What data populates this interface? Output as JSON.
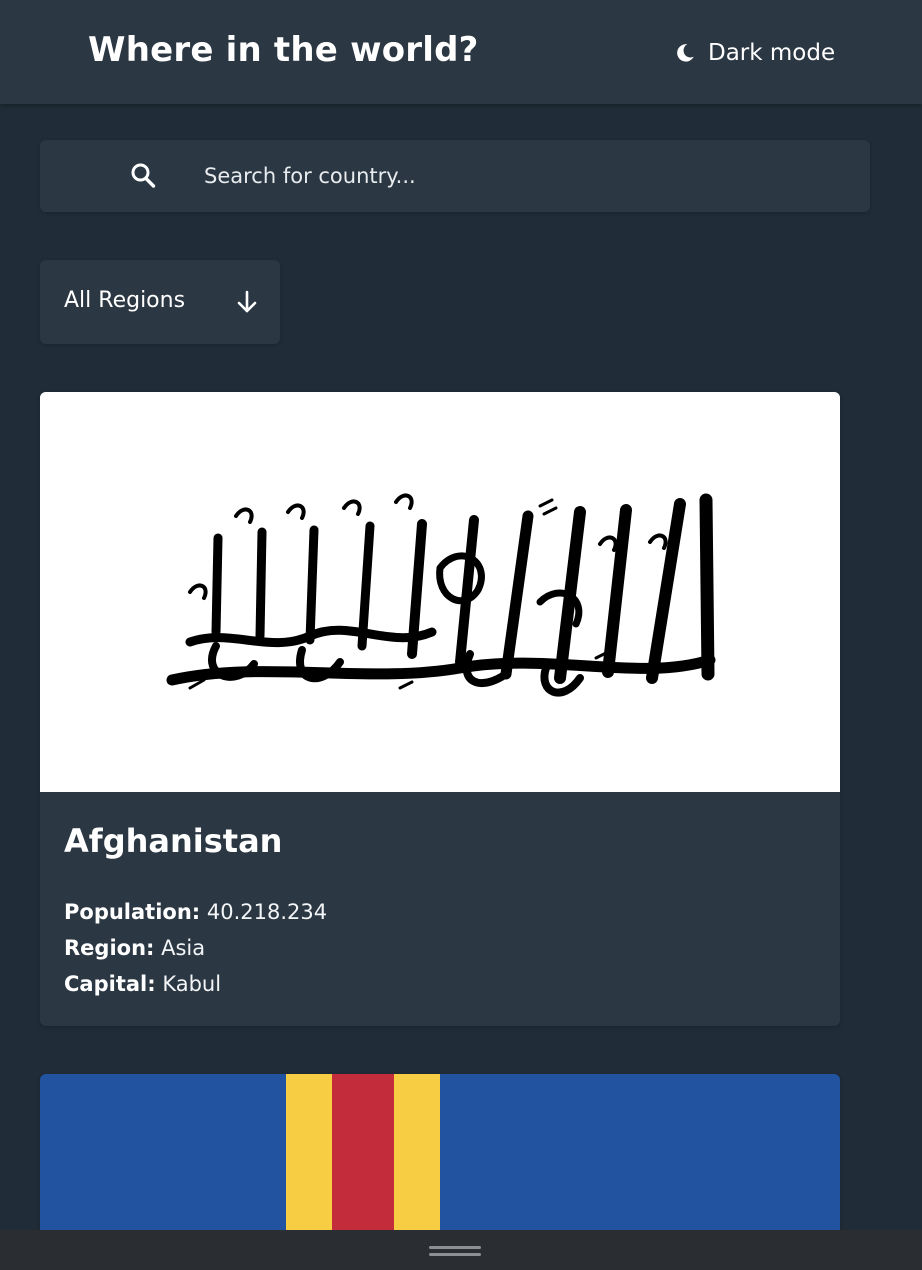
{
  "header": {
    "title": "Where in the world?",
    "mode_label": "Dark mode"
  },
  "search": {
    "placeholder": "Search for country...",
    "value": ""
  },
  "filter": {
    "selected": "All Regions"
  },
  "countries": [
    {
      "name": "Afghanistan",
      "population_label": "Population:",
      "population": "40.218.234",
      "region_label": "Region:",
      "region": "Asia",
      "capital_label": "Capital:",
      "capital": "Kabul",
      "flag_icon": "afghanistan-flag",
      "flag_colors": [
        "#ffffff",
        "#000000"
      ]
    },
    {
      "flag_icon": "aland-islands-flag",
      "flag_colors": [
        "#2153a0",
        "#f7cd44",
        "#c32d3b"
      ]
    }
  ],
  "colors": {
    "background": "#202c37",
    "element": "#2b3743",
    "text": "#ffffff"
  }
}
